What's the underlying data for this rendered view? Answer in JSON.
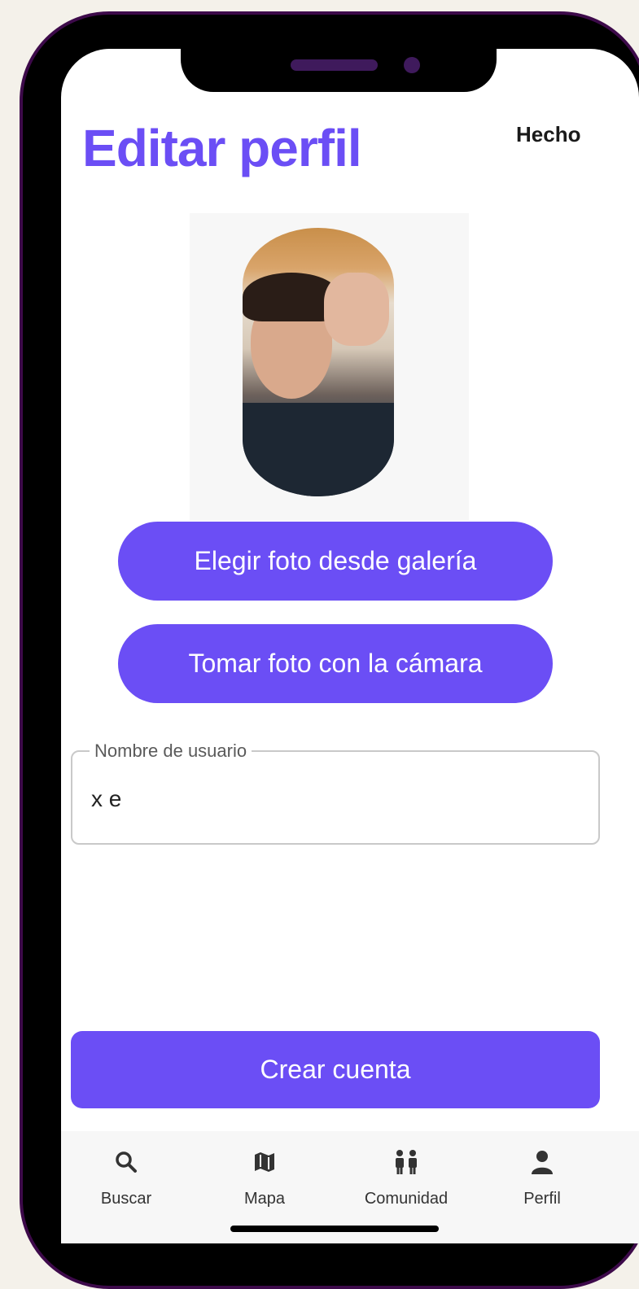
{
  "header": {
    "title": "Editar perfil",
    "done_label": "Hecho"
  },
  "buttons": {
    "gallery": "Elegir foto desde galería",
    "camera": "Tomar foto con la cámara",
    "create": "Crear cuenta"
  },
  "username": {
    "label": "Nombre de usuario",
    "value": "x e"
  },
  "tabs": [
    {
      "label": "Buscar",
      "icon": "search-icon"
    },
    {
      "label": "Mapa",
      "icon": "map-icon"
    },
    {
      "label": "Comunidad",
      "icon": "community-icon"
    },
    {
      "label": "Perfil",
      "icon": "profile-icon"
    }
  ],
  "colors": {
    "accent": "#6b4ef5",
    "frame": "#3d0a4a"
  }
}
